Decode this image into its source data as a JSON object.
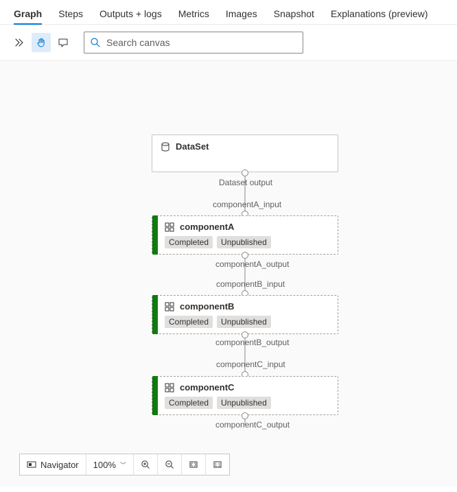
{
  "tabs": {
    "graph": "Graph",
    "steps": "Steps",
    "outputs_logs": "Outputs + logs",
    "metrics": "Metrics",
    "images": "Images",
    "snapshot": "Snapshot",
    "explanations": "Explanations (preview)"
  },
  "toolbar": {
    "search_placeholder": "Search canvas"
  },
  "graph": {
    "dataset": {
      "title": "DataSet"
    },
    "compA": {
      "title": "componentA"
    },
    "compB": {
      "title": "componentB"
    },
    "compC": {
      "title": "componentC"
    },
    "badge_completed": "Completed",
    "badge_unpublished": "Unpublished",
    "ports": {
      "dataset_out": "Dataset output",
      "a_in": "componentA_input",
      "a_out": "componentA_output",
      "b_in": "componentB_input",
      "b_out": "componentB_output",
      "c_in": "componentC_input",
      "c_out": "componentC_output"
    }
  },
  "navigator": {
    "label": "Navigator",
    "zoom": "100%"
  }
}
